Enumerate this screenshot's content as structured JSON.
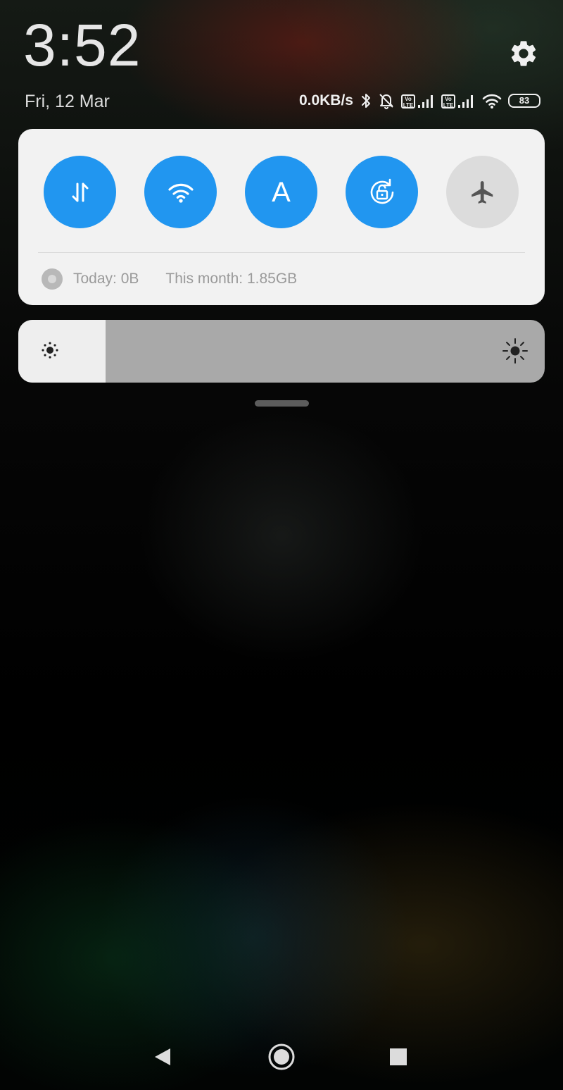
{
  "status_bar": {
    "time": "3:52",
    "date": "Fri, 12 Mar",
    "net_speed": "0.0KB/s",
    "volte_label_top": "Vo",
    "volte_label_bottom": "LTE",
    "battery_level": "83",
    "icons": [
      "settings-icon",
      "bluetooth-icon",
      "notifications-off-icon",
      "volte-icon",
      "signal-icon",
      "volte-icon",
      "signal-icon",
      "wifi-icon",
      "battery-icon"
    ]
  },
  "quick_settings": {
    "toggles": [
      {
        "name": "mobile-data",
        "icon": "data-arrows-icon",
        "active": true
      },
      {
        "name": "wifi",
        "icon": "wifi-icon",
        "active": true
      },
      {
        "name": "auto-brightness",
        "icon": "letter-a-icon",
        "label": "A",
        "active": true
      },
      {
        "name": "auto-rotate",
        "icon": "rotation-lock-icon",
        "active": true
      },
      {
        "name": "airplane-mode",
        "icon": "airplane-icon",
        "active": false
      }
    ],
    "accent_color": "#2196f0",
    "inactive_color": "#dcdcdc"
  },
  "data_usage": {
    "today": "Today: 0B",
    "month": "This month: 1.85GB"
  },
  "brightness": {
    "level": 0.166
  },
  "navigation": {
    "buttons": [
      "back-icon",
      "home-icon",
      "recents-icon"
    ]
  }
}
